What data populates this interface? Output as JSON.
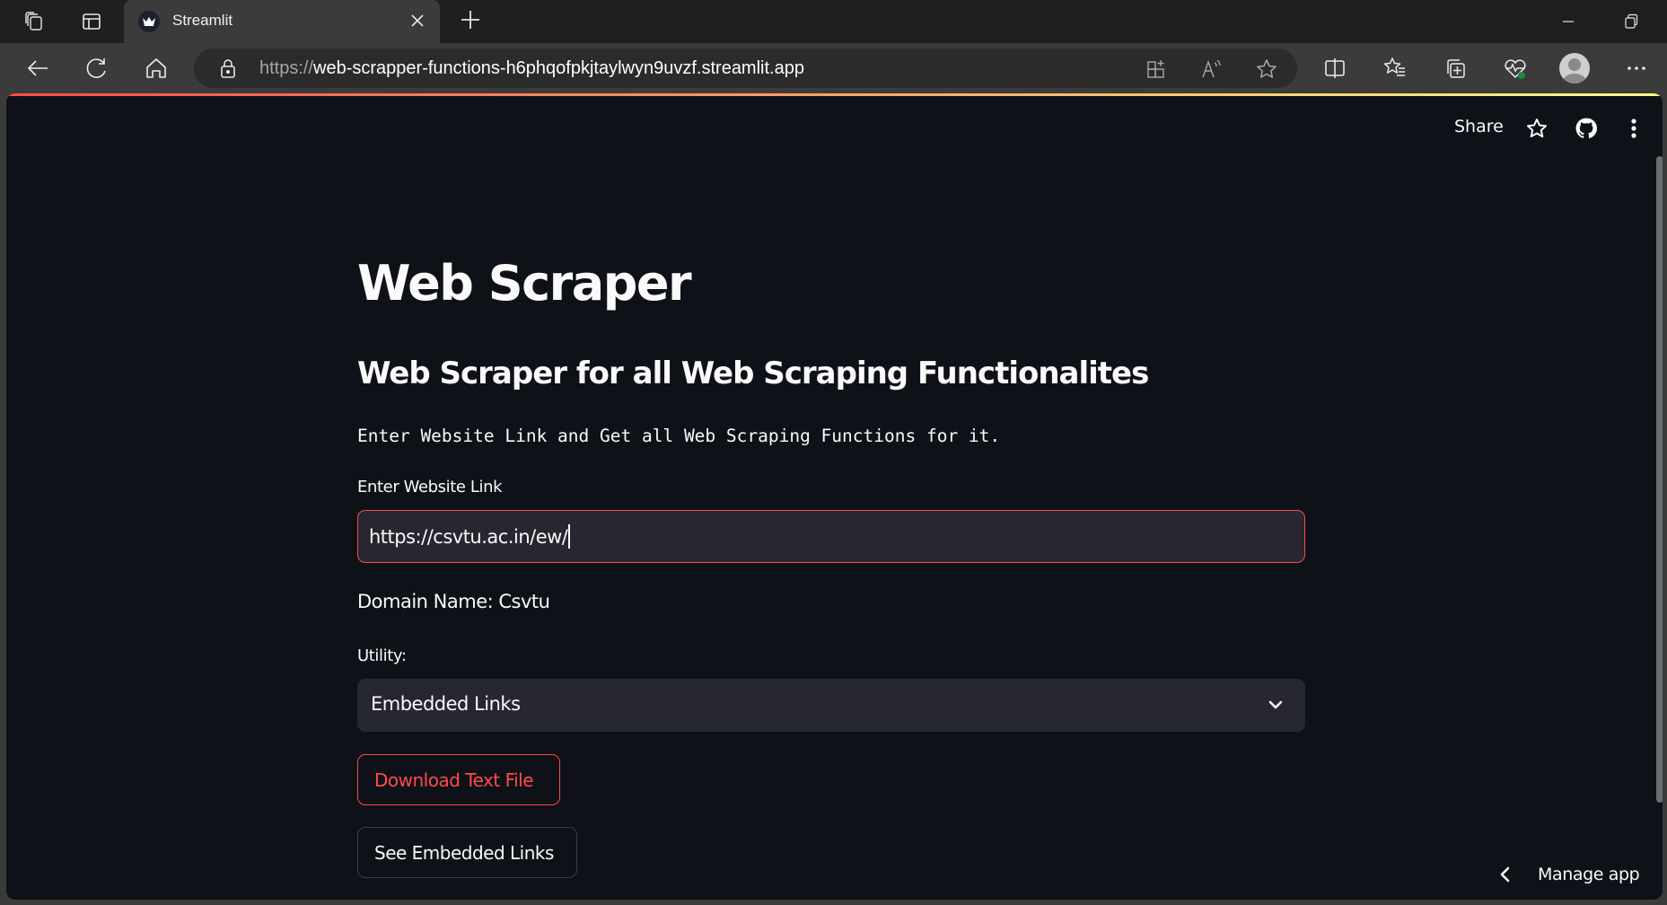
{
  "browser": {
    "tab": {
      "title": "Streamlit",
      "favicon": "streamlit-crown-icon"
    },
    "new_tab_icon": "plus-icon",
    "window_controls": [
      "minimize-icon",
      "restore-icon"
    ],
    "address": {
      "scheme": "https://",
      "host_path": "web-scrapper-functions-h6phqofpkjtaylwyn9uvzf.streamlit.app"
    },
    "toolbar_icons": [
      "back-icon",
      "refresh-icon",
      "home-icon",
      "lock-icon",
      "app-available-icon",
      "read-aloud-icon",
      "favorite-star-icon",
      "split-screen-icon",
      "favorites-icon",
      "collections-icon",
      "browser-essentials-icon",
      "profile-avatar",
      "more-icon"
    ]
  },
  "app_header": {
    "share_label": "Share",
    "icons": [
      "star-icon",
      "github-icon",
      "kebab-menu-icon"
    ]
  },
  "main": {
    "title": "Web Scraper",
    "subtitle": "Web Scraper for all Web Scraping Functionalites",
    "description": "Enter Website Link and Get all Web Scraping Functions for it.",
    "link_input": {
      "label": "Enter Website Link",
      "value": "https://csvtu.ac.in/ew/"
    },
    "domain_text": "Domain Name: Csvtu",
    "utility_select": {
      "label": "Utility:",
      "selected": "Embedded Links"
    },
    "download_button": "Download Text File",
    "see_button": "See Embedded Links"
  },
  "footer": {
    "manage_app_label": "Manage app"
  },
  "colors": {
    "background": "#0e1117",
    "accent": "#ff4b4b",
    "input_bg": "#262730",
    "text": "#fafafa"
  }
}
